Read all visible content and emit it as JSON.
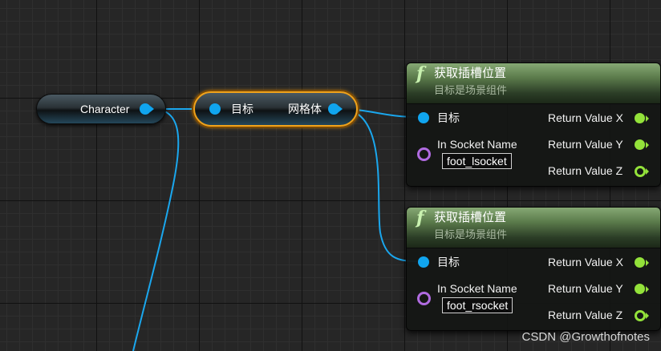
{
  "character_node": {
    "label": "Character"
  },
  "mesh_node": {
    "input_label": "目标",
    "output_label": "网格体"
  },
  "socket_nodes": [
    {
      "title": "获取插槽位置",
      "subtitle": "目标是场景组件",
      "target_label": "目标",
      "socket_name_label": "In Socket Name",
      "socket_value": "foot_lsocket",
      "outputs": [
        "Return Value X",
        "Return Value Y",
        "Return Value Z"
      ]
    },
    {
      "title": "获取插槽位置",
      "subtitle": "目标是场景组件",
      "target_label": "目标",
      "socket_name_label": "In Socket Name",
      "socket_value": "foot_rsocket",
      "outputs": [
        "Return Value X",
        "Return Value Y",
        "Return Value Z"
      ]
    }
  ],
  "icons": {
    "function": "function-icon",
    "object_pin": "object-pin-icon",
    "name_pin": "name-pin-icon",
    "float_pin": "float-pin-icon"
  },
  "colors": {
    "object_pin": "#10a5ef",
    "float_pin": "#93e23a",
    "name_pin": "#b06be0",
    "selection": "#f0a21a",
    "function_header": "#5c7c4c"
  },
  "watermark": "CSDN @Growthofnotes"
}
